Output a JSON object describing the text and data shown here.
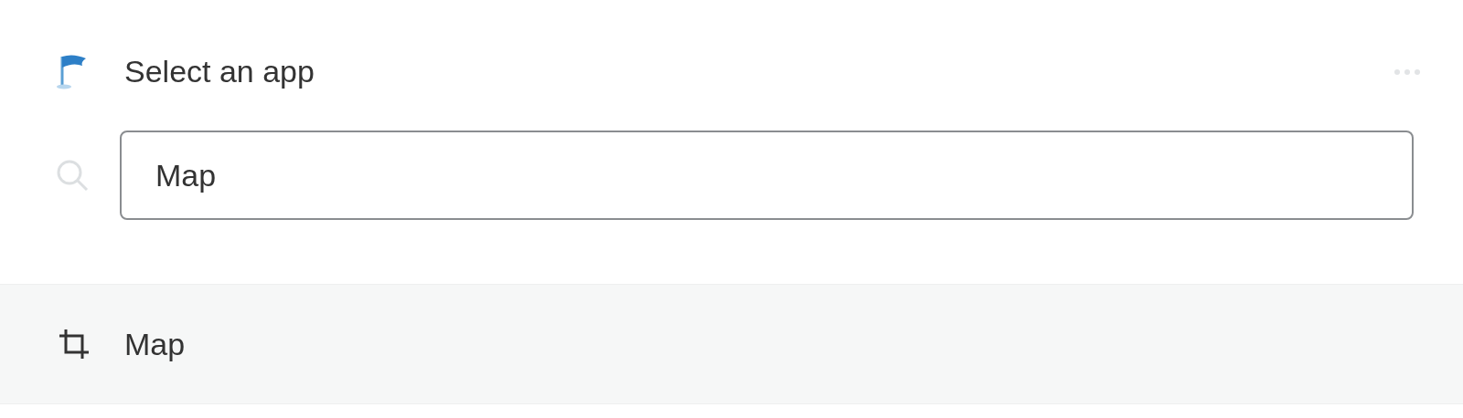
{
  "header": {
    "title": "Select an app"
  },
  "search": {
    "value": "Map"
  },
  "results": [
    {
      "label": "Map",
      "selected": true
    }
  ]
}
